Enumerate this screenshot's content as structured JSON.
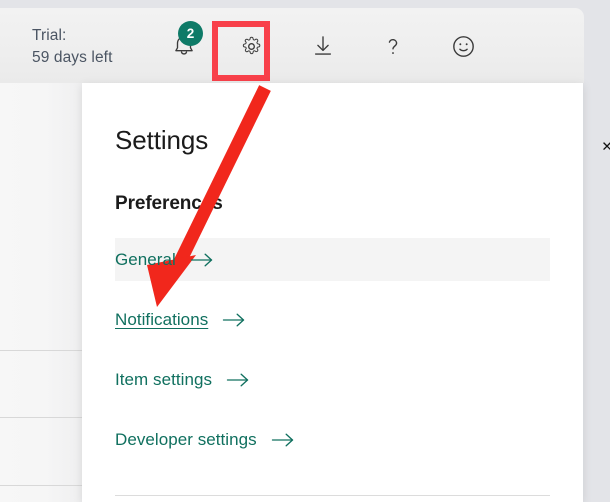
{
  "topbar": {
    "trial": {
      "label_line1": "Trial:",
      "label_line2": "59 days left"
    },
    "icons": [
      {
        "name": "notifications-bell-icon",
        "label": "Notifications"
      },
      {
        "name": "settings-gear-icon",
        "label": "Settings"
      },
      {
        "name": "download-icon",
        "label": "Download"
      },
      {
        "name": "help-question-icon",
        "label": "Help"
      },
      {
        "name": "feedback-smiley-icon",
        "label": "Feedback"
      }
    ],
    "notification_badge_count": "2",
    "badge_color": "#0e7a67",
    "highlight_color": "#f8404a"
  },
  "panel": {
    "title": "Settings",
    "close_label": "✕",
    "section_heading": "Preferences",
    "links": [
      {
        "label": "General",
        "arrow": "→",
        "state": "hover"
      },
      {
        "label": "Notifications",
        "arrow": "→",
        "state": "focus"
      },
      {
        "label": "Item settings",
        "arrow": "→",
        "state": "normal"
      },
      {
        "label": "Developer settings",
        "arrow": "→",
        "state": "normal"
      }
    ],
    "link_color": "#10705f"
  },
  "annotation": {
    "arrow_color": "#f1271c",
    "arrow_from": "265,88",
    "arrow_to": "157,307"
  }
}
